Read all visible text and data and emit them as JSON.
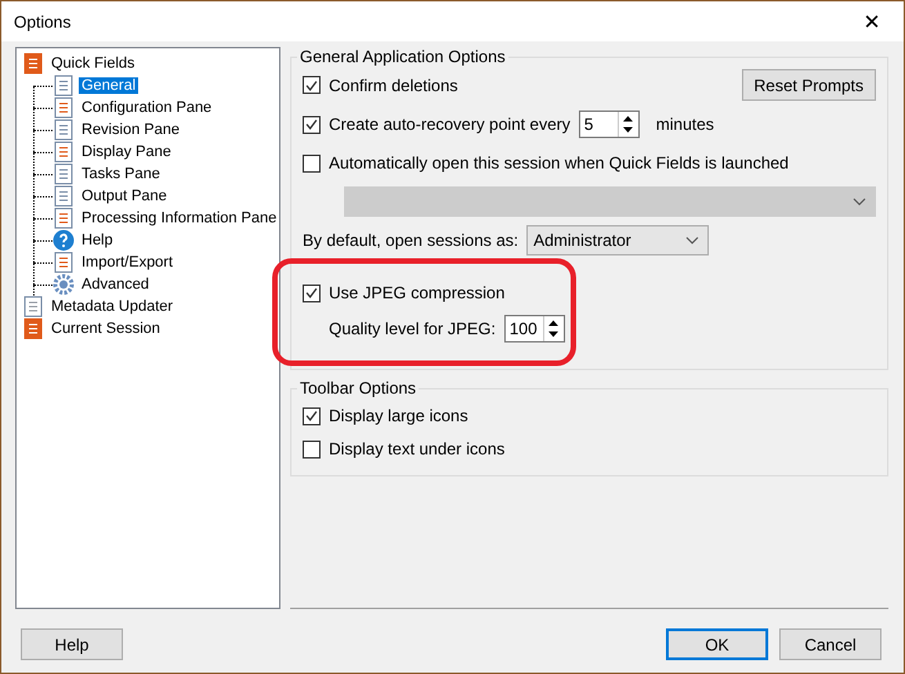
{
  "window": {
    "title": "Options",
    "close": "✕"
  },
  "tree": [
    {
      "label": "Quick Fields",
      "selected": false,
      "children": [
        {
          "label": "General",
          "selected": true
        },
        {
          "label": "Configuration Pane",
          "selected": false
        },
        {
          "label": "Revision Pane",
          "selected": false
        },
        {
          "label": "Display Pane",
          "selected": false
        },
        {
          "label": "Tasks Pane",
          "selected": false
        },
        {
          "label": "Output Pane",
          "selected": false
        },
        {
          "label": "Processing Information Pane",
          "selected": false
        },
        {
          "label": "Help",
          "selected": false
        },
        {
          "label": "Import/Export",
          "selected": false
        },
        {
          "label": "Advanced",
          "selected": false
        }
      ]
    },
    {
      "label": "Metadata Updater",
      "selected": false
    },
    {
      "label": "Current Session",
      "selected": false
    }
  ],
  "general": {
    "title": "General Application Options",
    "confirm": {
      "label": "Confirm deletions",
      "checked": true
    },
    "reset_button": "Reset Prompts",
    "autorecovery": {
      "label": "Create auto-recovery point every",
      "checked": true,
      "value": "5",
      "suffix": "minutes"
    },
    "auto_open": {
      "label": "Automatically open this session when Quick Fields is launched",
      "checked": false
    },
    "session_dropdown": {
      "disabled": true
    },
    "default_open": {
      "label": "By default, open sessions as:",
      "value": "Administrator"
    },
    "jpeg": {
      "label": "Use JPEG compression",
      "checked": true
    },
    "quality": {
      "label": "Quality level for JPEG:",
      "value": "100"
    }
  },
  "toolbar": {
    "title": "Toolbar Options",
    "options": [
      {
        "label": "Display large icons",
        "checked": true
      },
      {
        "label": "Display text under icons",
        "checked": false
      }
    ]
  },
  "buttons": {
    "help": "Help",
    "ok": {
      "label": "OK",
      "default": true
    },
    "cancel": "Cancel"
  }
}
